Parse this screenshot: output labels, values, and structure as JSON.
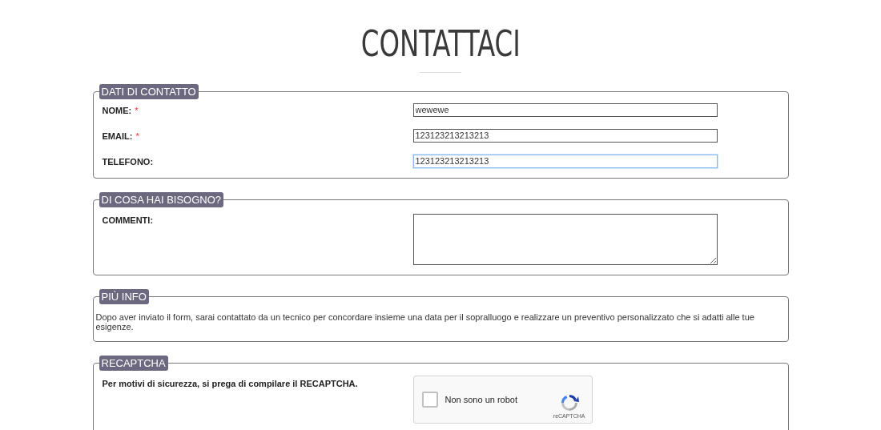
{
  "title": "CONTATTACI",
  "sections": [
    {
      "legend": "DATI DI CONTATTO",
      "kind": "fields",
      "fields": [
        {
          "label": "NOME:",
          "required_mark": "*",
          "value": "wewewe",
          "focused": false
        },
        {
          "label": "EMAIL:",
          "required_mark": "*",
          "value": "123123213213213",
          "focused": false
        },
        {
          "label": "TELEFONO:",
          "value": "123123213213213",
          "focused": true
        }
      ]
    },
    {
      "legend": "DI COSA HAI BISOGNO?",
      "kind": "textarea",
      "label": "COMMENTI:"
    },
    {
      "legend": "PIÙ INFO",
      "kind": "text",
      "text": "Dopo aver inviato il form, sarai contattato da un tecnico per concordare insieme una data per il sopralluogo e realizzare un preventivo personalizzato che si adatti alle tue esigenze."
    },
    {
      "legend": "RECAPTCHA",
      "kind": "captcha",
      "note": "Per motivi di sicurezza, si prega di compilare il RECAPTCHA.",
      "captcha": {
        "checked": false,
        "label": "Non sono un robot",
        "brand": "reCAPTCHA"
      }
    }
  ]
}
